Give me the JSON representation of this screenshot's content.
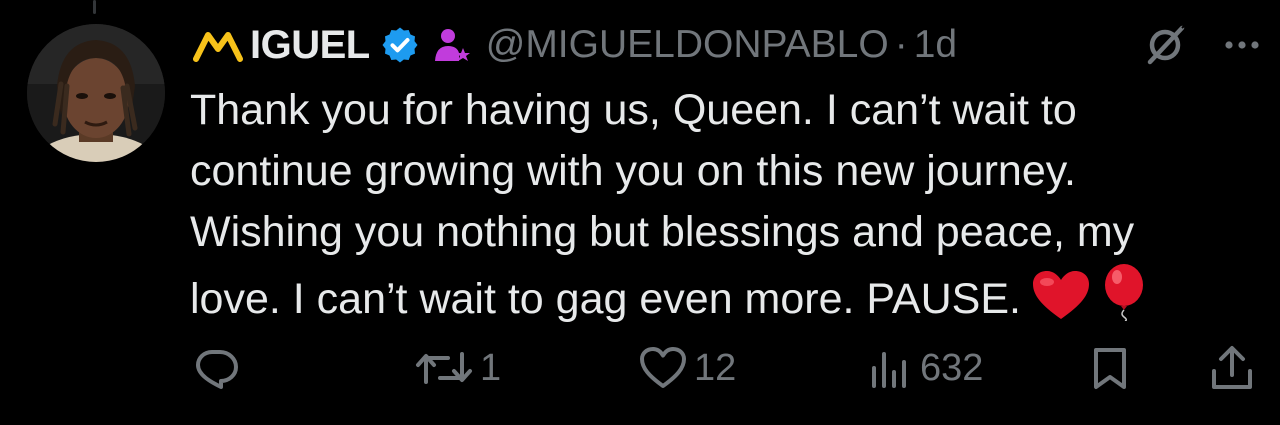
{
  "tweet": {
    "author": {
      "display_name": "IGUEL",
      "logo_icon": "gold-m-logo-icon",
      "verified_icon": "verified-badge-icon",
      "affiliate_icon": "affiliate-person-icon",
      "handle": "@MIGUELDONPABLO",
      "separator": "·",
      "time": "1d"
    },
    "text_lines": [
      "Thank you for having us, Queen. I can’t wait to",
      "continue growing with you on this new journey.",
      "Wishing you nothing but blessings and peace, my",
      "love. I can’t wait to gag even more. PAUSE."
    ],
    "emojis": [
      "red-heart-emoji",
      "red-balloon-emoji"
    ],
    "actions": {
      "reply": {
        "icon": "reply-icon",
        "count": ""
      },
      "repost": {
        "icon": "repost-icon",
        "count": "1"
      },
      "like": {
        "icon": "heart-icon",
        "count": "12"
      },
      "views": {
        "icon": "views-chart-icon",
        "count": "632"
      },
      "bookmark": {
        "icon": "bookmark-icon"
      },
      "share": {
        "icon": "share-icon"
      }
    },
    "header_icons": [
      "grok-icon",
      "more-icon"
    ]
  },
  "colors": {
    "background": "#000000",
    "text_primary": "#e7e9ea",
    "text_secondary": "#71767b",
    "verified_blue": "#1d9bf0",
    "affiliate_purple": "#c13cdc",
    "logo_gold": "#f7c21a",
    "heart_red": "#e0142a"
  }
}
